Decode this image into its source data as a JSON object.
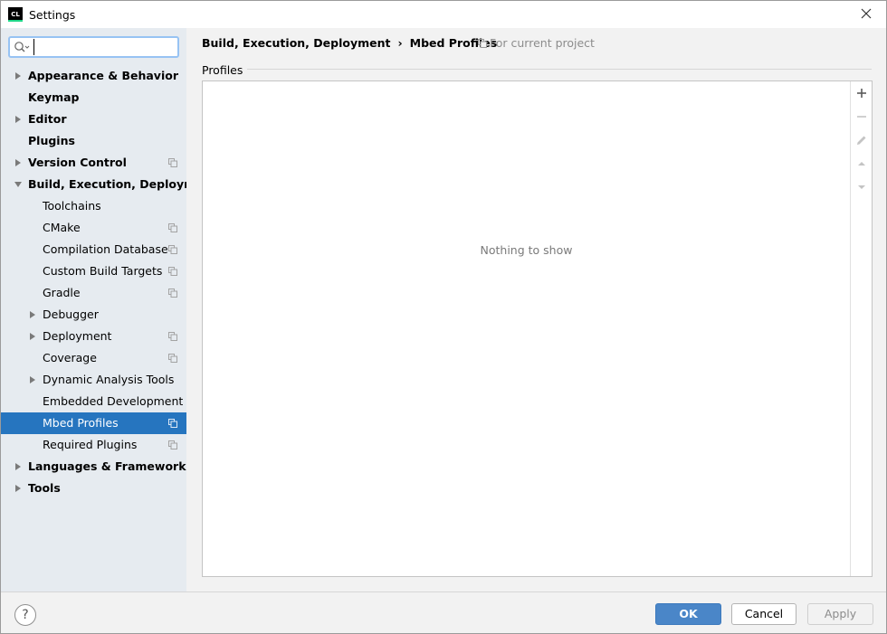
{
  "window": {
    "title": "Settings",
    "app_icon_text": "CL"
  },
  "search": {
    "value": "",
    "placeholder": ""
  },
  "tree": [
    {
      "label": "Appearance & Behavior",
      "level": 0,
      "arrow": "right",
      "project": false
    },
    {
      "label": "Keymap",
      "level": 0,
      "arrow": "none",
      "project": false
    },
    {
      "label": "Editor",
      "level": 0,
      "arrow": "right",
      "project": false
    },
    {
      "label": "Plugins",
      "level": 0,
      "arrow": "none",
      "project": false
    },
    {
      "label": "Version Control",
      "level": 0,
      "arrow": "right",
      "project": true
    },
    {
      "label": "Build, Execution, Deployment",
      "level": 0,
      "arrow": "down",
      "project": false
    },
    {
      "label": "Toolchains",
      "level": 1,
      "arrow": "none",
      "project": false
    },
    {
      "label": "CMake",
      "level": 1,
      "arrow": "none",
      "project": true
    },
    {
      "label": "Compilation Database",
      "level": 1,
      "arrow": "none",
      "project": true
    },
    {
      "label": "Custom Build Targets",
      "level": 1,
      "arrow": "none",
      "project": true
    },
    {
      "label": "Gradle",
      "level": 1,
      "arrow": "none",
      "project": true
    },
    {
      "label": "Debugger",
      "level": 1,
      "arrow": "right",
      "project": false
    },
    {
      "label": "Deployment",
      "level": 1,
      "arrow": "right",
      "project": true
    },
    {
      "label": "Coverage",
      "level": 1,
      "arrow": "none",
      "project": true
    },
    {
      "label": "Dynamic Analysis Tools",
      "level": 1,
      "arrow": "right",
      "project": false
    },
    {
      "label": "Embedded Development",
      "level": 1,
      "arrow": "none",
      "project": false
    },
    {
      "label": "Mbed Profiles",
      "level": 1,
      "arrow": "none",
      "project": true,
      "selected": true
    },
    {
      "label": "Required Plugins",
      "level": 1,
      "arrow": "none",
      "project": true
    },
    {
      "label": "Languages & Frameworks",
      "level": 0,
      "arrow": "right",
      "project": false
    },
    {
      "label": "Tools",
      "level": 0,
      "arrow": "right",
      "project": false
    }
  ],
  "breadcrumb": {
    "parent": "Build, Execution, Deployment",
    "separator": "›",
    "current": "Mbed Profiles",
    "scope": "For current project"
  },
  "section": {
    "title": "Profiles",
    "empty_text": "Nothing to show"
  },
  "toolbar": {
    "add": "plus-icon",
    "remove": "minus-icon",
    "edit": "pencil-icon",
    "up": "arrow-up-icon",
    "down": "arrow-down-icon"
  },
  "footer": {
    "help_label": "?",
    "ok_label": "OK",
    "cancel_label": "Cancel",
    "apply_label": "Apply"
  },
  "colors": {
    "selection": "#2675bf",
    "sidebar_bg": "#e6ebf0",
    "ok_button": "#4a86c8"
  }
}
